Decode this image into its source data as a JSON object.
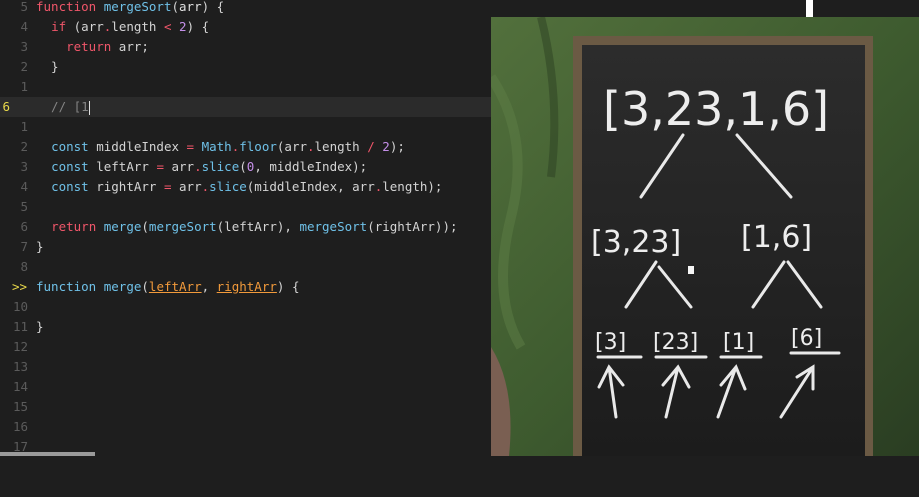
{
  "editor": {
    "lines": [
      {
        "n": "5",
        "code": "function mergeSort(arr) {"
      },
      {
        "n": "4",
        "code": "  if (arr.length < 2) {"
      },
      {
        "n": "3",
        "code": "    return arr;"
      },
      {
        "n": "2",
        "code": "  }"
      },
      {
        "n": "1",
        "code": ""
      },
      {
        "n": "6",
        "code": "  // [1"
      },
      {
        "n": "1",
        "code": ""
      },
      {
        "n": "2",
        "code": "  const middleIndex = Math.floor(arr.length / 2);"
      },
      {
        "n": "3",
        "code": "  const leftArr = arr.slice(0, middleIndex);"
      },
      {
        "n": "4",
        "code": "  const rightArr = arr.slice(middleIndex, arr.length);"
      },
      {
        "n": "5",
        "code": ""
      },
      {
        "n": "6",
        "code": "  return merge(mergeSort(leftArr), mergeSort(rightArr));"
      },
      {
        "n": "7",
        "code": "}"
      },
      {
        "n": "8",
        "code": ""
      },
      {
        "n": ">>",
        "code": "function merge(leftArr, rightArr) {"
      },
      {
        "n": "10",
        "code": ""
      },
      {
        "n": "11",
        "code": "}"
      },
      {
        "n": "12",
        "code": ""
      },
      {
        "n": "13",
        "code": ""
      },
      {
        "n": "14",
        "code": ""
      },
      {
        "n": "15",
        "code": ""
      },
      {
        "n": "16",
        "code": ""
      },
      {
        "n": "17",
        "code": ""
      }
    ]
  },
  "chalkboard": {
    "root": "[3,23,1,6]",
    "left": "[3,23]",
    "right": "[1,6]",
    "leaves": [
      "[3]",
      "[23]",
      "[1]",
      "[6]"
    ]
  },
  "colors": {
    "keyword": "#f0566a",
    "function": "#6fc1e8",
    "number": "#c48fe8",
    "param": "#f29a3b",
    "background": "#1e1e1e"
  }
}
